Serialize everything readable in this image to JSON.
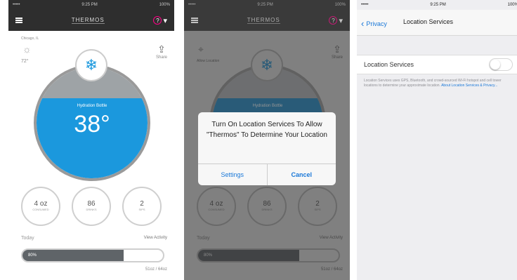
{
  "status": {
    "carrier": "••••• ",
    "time": "9:25 PM",
    "battery": "100%"
  },
  "app": {
    "logo": "THERMOS",
    "help_icon": "question-icon"
  },
  "weather": {
    "city": "Chicago, IL",
    "temp": "72°"
  },
  "share_label": "Share",
  "location": {
    "label": "Allow Location"
  },
  "bottle": {
    "label": "Hydration Bottle",
    "temp": "38°"
  },
  "stats": [
    {
      "value": "4 oz",
      "label": "Consumed"
    },
    {
      "value": "86",
      "label": "Drinks"
    },
    {
      "value": "2",
      "label": "Sips"
    }
  ],
  "today": {
    "label": "Today",
    "view_activity": "View Activity",
    "progress_pct": 80,
    "progress_text": "80%",
    "amount": "51oz / 64oz"
  },
  "dialog": {
    "message": "Turn On Location Services To Allow \"Thermos\" To Determine Your Location",
    "settings_button": "Settings",
    "cancel_button": "Cancel"
  },
  "settings": {
    "back_label": "Privacy",
    "title": "Location Services",
    "row_label": "Location Services",
    "toggle_on": false,
    "footer_text": "Location Services uses GPS, Bluetooth, and crowd-sourced Wi-Fi hotspot and cell tower locations to determine your approximate location. ",
    "footer_link": "About Location Services & Privacy..."
  },
  "colors": {
    "accent_blue": "#1b98dd",
    "ios_link": "#1a78d8",
    "nav_dark": "#2e2e2e"
  }
}
